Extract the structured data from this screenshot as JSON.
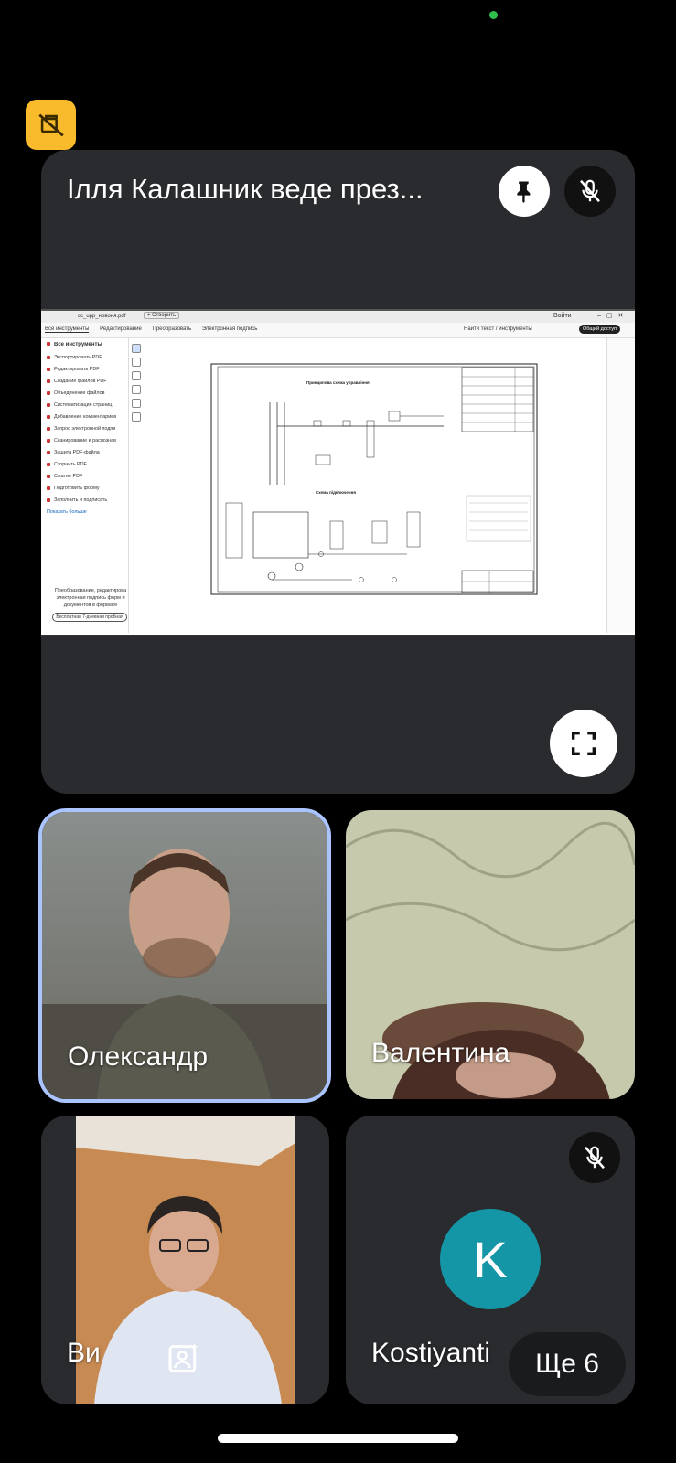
{
  "colors": {
    "background": "#000000",
    "tile": "#2a2b2e",
    "active_speaker_border": "#aac4ff",
    "recording_badge": "#f9bb2b",
    "avatar_k": "#1596a7",
    "status_dot": "#2fbf4f"
  },
  "presentation": {
    "title": "Ілля Калашник веде през...",
    "pin_icon": "pin-icon",
    "mute_icon": "mic-off-icon",
    "fullscreen_icon": "fullscreen-icon"
  },
  "shared_screen": {
    "window_tab": "cc_upp_новоня.pdf",
    "new_tab": "+ Створить",
    "signin": "Войти",
    "toolbar_tabs": [
      "Все инструменты",
      "Редактирование",
      "Преобразовать",
      "Электронная подпись"
    ],
    "search_placeholder": "Найти текст / инструменты",
    "share_button": "Общий доступ",
    "sidebar_title": "Все инструменты",
    "sidebar_items": [
      "Экспортировать PDF",
      "Редактировать PDF",
      "Создание файлов PDF",
      "Объединение файлов",
      "Систематизация страниц",
      "Добавление комментариев",
      "Запрос электронной подпи",
      "Сканирование и распознав",
      "Защита PDF-файла",
      "Сторнить PDF",
      "Сжатие PDF",
      "Подготовить форму",
      "Заполнить и подписать"
    ],
    "sidebar_more": "Показать больше",
    "promo_text": "Преобразование, редактирова электронная подпись форм и документов в формате",
    "promo_button": "Бесплатная 7-дневная пробная",
    "drawing_title_1": "Принципова схема управління",
    "drawing_title_2": "Схема підключення"
  },
  "participants": [
    {
      "name": "Олександр",
      "active": true
    },
    {
      "name": "Валентина",
      "active": false
    },
    {
      "name": "Ви",
      "active": false,
      "effects_icon": "portrait-effects-icon"
    },
    {
      "name": "Kostiyanti",
      "active": false,
      "avatar_letter": "K",
      "muted": true
    }
  ],
  "more_participants": "Ще 6"
}
